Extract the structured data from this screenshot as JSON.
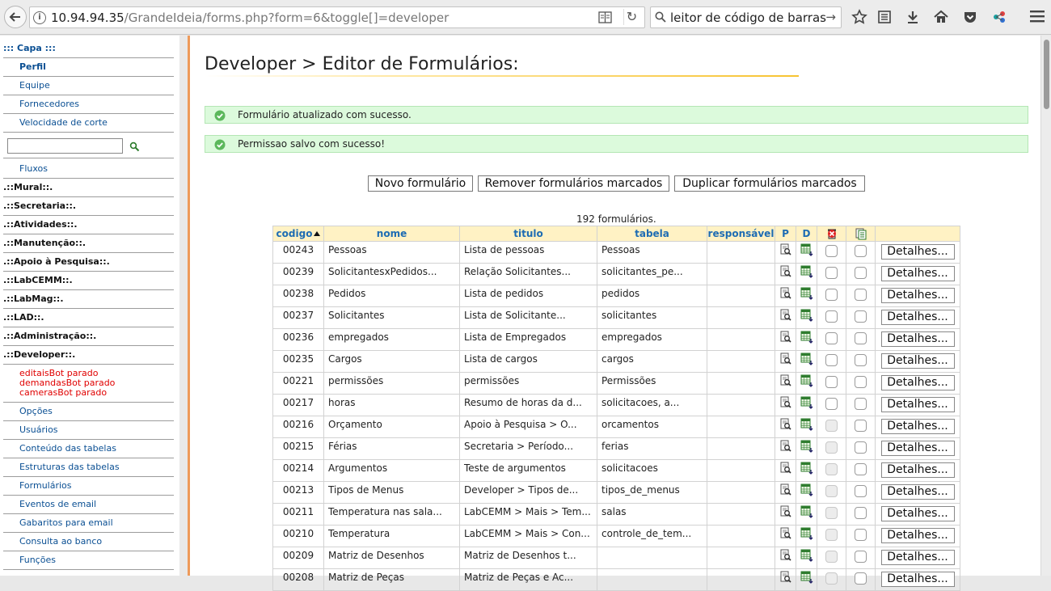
{
  "browser": {
    "url_host": "10.94.94.35",
    "url_path": "/GrandeIdeia/forms.php?form=6&toggle[]=developer",
    "search_text": "leitor de código de barras",
    "icons": [
      "back-arrow-icon",
      "site-info-icon",
      "reader-view-icon",
      "reload-icon",
      "search-icon",
      "search-go-icon",
      "bookmark-star-icon",
      "reading-list-icon",
      "download-icon",
      "home-icon",
      "pocket-icon",
      "extension-icon",
      "hamburger-menu-icon"
    ]
  },
  "nav": {
    "capa": "::: Capa :::",
    "perfil": "Perfil",
    "equipe": "Equipe",
    "fornecedores": "Fornecedores",
    "velocidade": "Velocidade de corte",
    "fluxos": "Fluxos",
    "mural": ".::Mural::.",
    "secretaria": ".::Secretaria::.",
    "atividades": ".::Atividades::.",
    "manutencao": ".::Manutenção::.",
    "apoio": ".::Apoio à Pesquisa::.",
    "labcemm": ".::LabCEMM::.",
    "labmag": ".::LabMag::.",
    "lad": ".::LAD::.",
    "administracao": ".::Administração::.",
    "developer": ".::Developer::.",
    "bots": [
      "editaisBot parado",
      "demandasBot parado",
      "camerasBot parado"
    ],
    "opcoes": "Opções",
    "usuarios": "Usuários",
    "conteudo": "Conteúdo das tabelas",
    "estruturas": "Estruturas das tabelas",
    "formularios": "Formulários",
    "eventos": "Eventos de email",
    "gabaritos": "Gabaritos para email",
    "consulta": "Consulta ao banco",
    "funcoes": "Funções"
  },
  "page": {
    "title": "Developer > Editor de Formulários:",
    "msg1": "Formulário atualizado com sucesso.",
    "msg2": "Permissao salvo com sucesso!",
    "btn_novo": "Novo formulário",
    "btn_remover": "Remover formulários marcados",
    "btn_duplicar": "Duplicar formulários marcados",
    "count": "192 formulários."
  },
  "table": {
    "headers": {
      "codigo": "codigo",
      "nome": "nome",
      "titulo": "titulo",
      "tabela": "tabela",
      "responsavel": "responsável",
      "p": "P",
      "d": "D"
    },
    "button_label": "Detalhes...",
    "rows": [
      {
        "codigo": "00243",
        "nome": "Pessoas",
        "titulo": "Lista de pessoas",
        "tabela": "Pessoas",
        "responsavel": "",
        "chk1_disabled": false
      },
      {
        "codigo": "00239",
        "nome": "SolicitantesxPedidos...",
        "titulo": "Relação Solicitantes...",
        "tabela": "solicitantes_pe...",
        "responsavel": "",
        "chk1_disabled": false
      },
      {
        "codigo": "00238",
        "nome": "Pedidos",
        "titulo": "Lista de pedidos",
        "tabela": "pedidos",
        "responsavel": "",
        "chk1_disabled": false
      },
      {
        "codigo": "00237",
        "nome": "Solicitantes",
        "titulo": "Lista de Solicitante...",
        "tabela": "solicitantes",
        "responsavel": "",
        "chk1_disabled": false
      },
      {
        "codigo": "00236",
        "nome": "empregados",
        "titulo": "Lista de Empregados",
        "tabela": "empregados",
        "responsavel": "",
        "chk1_disabled": false
      },
      {
        "codigo": "00235",
        "nome": "Cargos",
        "titulo": "Lista de cargos",
        "tabela": "cargos",
        "responsavel": "",
        "chk1_disabled": false
      },
      {
        "codigo": "00221",
        "nome": "permissões",
        "titulo": "permissões",
        "tabela": "Permissões",
        "responsavel": "",
        "chk1_disabled": false
      },
      {
        "codigo": "00217",
        "nome": "horas",
        "titulo": "Resumo de horas da d...",
        "tabela": "solicitacoes, a...",
        "responsavel": "",
        "chk1_disabled": false
      },
      {
        "codigo": "00216",
        "nome": "Orçamento",
        "titulo": "Apoio à Pesquisa > O...",
        "tabela": "orcamentos",
        "responsavel": "",
        "chk1_disabled": true
      },
      {
        "codigo": "00215",
        "nome": "Férias",
        "titulo": "Secretaria > Período...",
        "tabela": "ferias",
        "responsavel": "",
        "chk1_disabled": true
      },
      {
        "codigo": "00214",
        "nome": "Argumentos",
        "titulo": "Teste de argumentos",
        "tabela": "solicitacoes",
        "responsavel": "",
        "chk1_disabled": true
      },
      {
        "codigo": "00213",
        "nome": "Tipos de Menus",
        "titulo": "Developer > Tipos de...",
        "tabela": "tipos_de_menus",
        "responsavel": "",
        "chk1_disabled": true
      },
      {
        "codigo": "00211",
        "nome": "Temperatura nas sala...",
        "titulo": "LabCEMM > Mais > Tem...",
        "tabela": "salas",
        "responsavel": "",
        "chk1_disabled": true
      },
      {
        "codigo": "00210",
        "nome": "Temperatura",
        "titulo": "LabCEMM > Mais > Con...",
        "tabela": "controle_de_tem...",
        "responsavel": "",
        "chk1_disabled": true
      },
      {
        "codigo": "00209",
        "nome": "Matriz de Desenhos",
        "titulo": "Matriz de Desenhos t...",
        "tabela": "",
        "responsavel": "",
        "chk1_disabled": true
      },
      {
        "codigo": "00208",
        "nome": "Matriz de Peças",
        "titulo": "Matriz de Peças e Ac...",
        "tabela": "",
        "responsavel": "",
        "chk1_disabled": true
      }
    ]
  },
  "colors": {
    "accent_link": "#0a4f93",
    "header_bg": "#fff2c4",
    "success_bg": "#dcfadc",
    "bot_status": "#e00000",
    "orange_bar": "#ee9a5a"
  }
}
